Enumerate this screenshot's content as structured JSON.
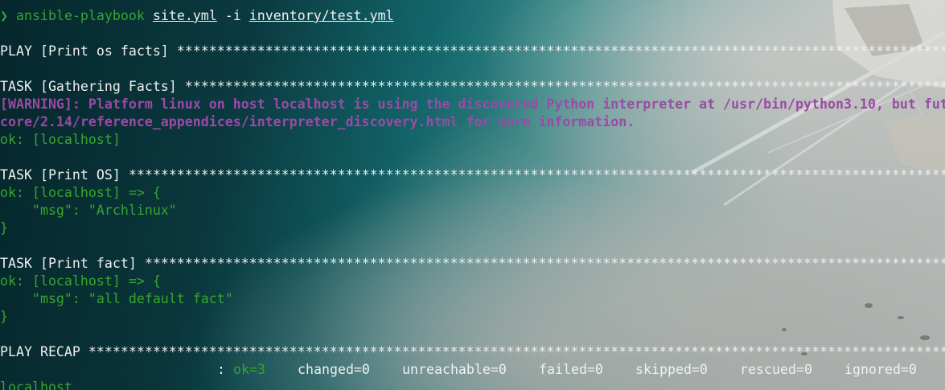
{
  "terminal": {
    "prompt": {
      "arrow": "❯",
      "command": "ansible-playbook",
      "arg_playbook": "site.yml",
      "flag": "-i",
      "arg_inventory": "inventory/test.yml"
    },
    "lines": {
      "play_header": "PLAY [Print os facts] ",
      "task_gathering": "TASK [Gathering Facts] ",
      "warning_1": "[WARNING]: Platform linux on host localhost is using the discovered Python interpreter at /usr/bin/python3.10, but fut",
      "warning_2": "core/2.14/reference_appendices/interpreter_discovery.html for more information.",
      "ok_gathering": "ok: [localhost]",
      "task_print_os": "TASK [Print OS] ",
      "ok_print_os": "ok: [localhost] => {",
      "msg_print_os": "    \"msg\": \"Archlinux\"",
      "close_print_os": "}",
      "task_print_fact": "TASK [Print fact] ",
      "ok_print_fact": "ok: [localhost] => {",
      "msg_print_fact": "    \"msg\": \"all default fact\"",
      "close_print_fact": "}",
      "play_recap": "PLAY RECAP "
    },
    "star_fill": "****************************************************************************************************************************************",
    "recap": {
      "host": "localhost",
      "colon": ":",
      "ok": "ok=3",
      "changed": "changed=0",
      "unreachable": "unreachable=0",
      "failed": "failed=0",
      "skipped": "skipped=0",
      "rescued": "rescued=0",
      "ignored": "ignored=0"
    },
    "colors": {
      "text": "#f0f0f0",
      "ok_green": "#36a62e",
      "warning_purple": "#9b4aa6"
    }
  }
}
